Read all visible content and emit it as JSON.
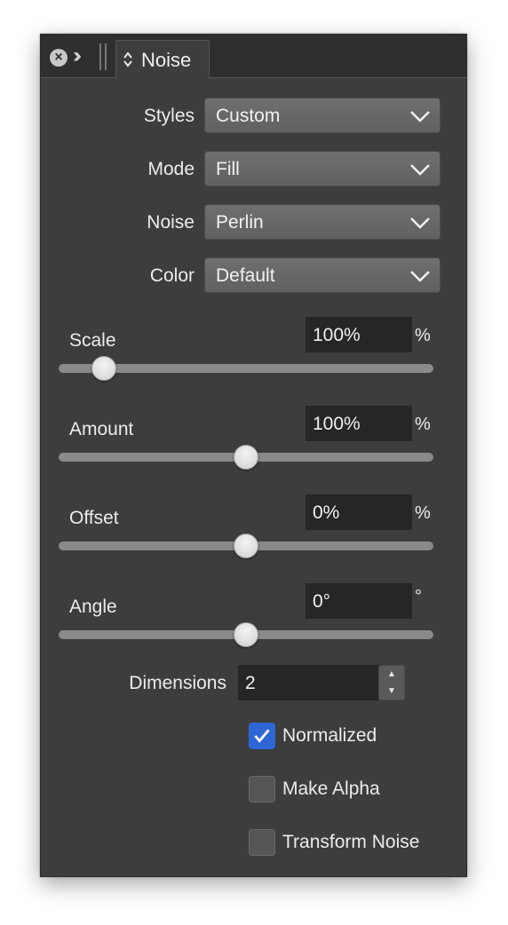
{
  "panel": {
    "tab": {
      "label": "Noise"
    }
  },
  "selects": [
    {
      "label": "Styles",
      "value": "Custom"
    },
    {
      "label": "Mode",
      "value": "Fill"
    },
    {
      "label": "Noise",
      "value": "Perlin"
    },
    {
      "label": "Color",
      "value": "Default"
    }
  ],
  "sliders": [
    {
      "label": "Scale",
      "value": "100%",
      "unit": "%",
      "level": 0.12
    },
    {
      "label": "Amount",
      "value": "100%",
      "unit": "%",
      "level": 0.5
    },
    {
      "label": "Offset",
      "value": "0%",
      "unit": "%",
      "level": 0.5
    },
    {
      "label": "Angle",
      "value": "0°",
      "unit": "°",
      "level": 0.5
    }
  ],
  "dimensions": {
    "label": "Dimensions",
    "value": "2"
  },
  "checkboxes": [
    {
      "label": "Normalized",
      "checked": true
    },
    {
      "label": "Make Alpha",
      "checked": false
    },
    {
      "label": "Transform Noise",
      "checked": false
    }
  ],
  "colors": {
    "panel_bg": "#3d3d3d",
    "accent": "#2f66d6",
    "field_bg": "#262626"
  }
}
